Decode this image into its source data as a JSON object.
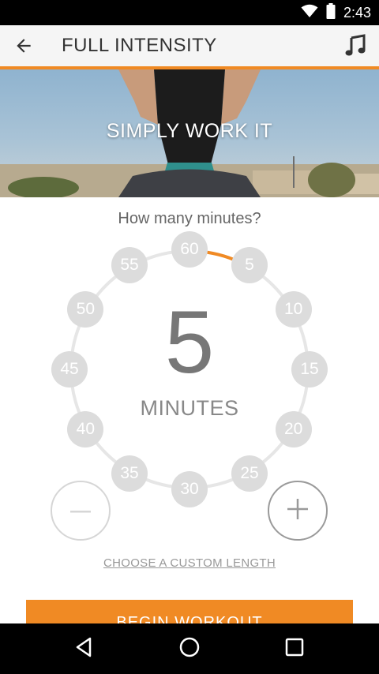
{
  "status_bar": {
    "time": "2:43",
    "icons": [
      "wifi-icon",
      "battery-icon"
    ]
  },
  "app_bar": {
    "title": "FULL INTENSITY",
    "back_icon": "arrow-left-icon",
    "music_icon": "music-note-icon"
  },
  "hero": {
    "caption": "SIMPLY WORK IT"
  },
  "picker": {
    "question": "How many minutes?",
    "options": [
      "60",
      "5",
      "10",
      "15",
      "20",
      "25",
      "30",
      "35",
      "40",
      "45",
      "50",
      "55"
    ],
    "selected_value": "5",
    "unit_label": "MINUTES",
    "progress_fraction": 0.0833
  },
  "controls": {
    "minus_symbol": "−",
    "plus_symbol": "+"
  },
  "custom_link": "CHOOSE A CUSTOM LENGTH",
  "begin_button": "BEGIN WORKOUT",
  "colors": {
    "accent": "#f08a24",
    "option_bg": "#dcdcdc",
    "ring": "#e6e6e6"
  },
  "nav_bar": {
    "icons": [
      "back-triangle-icon",
      "home-circle-icon",
      "recents-square-icon"
    ]
  }
}
